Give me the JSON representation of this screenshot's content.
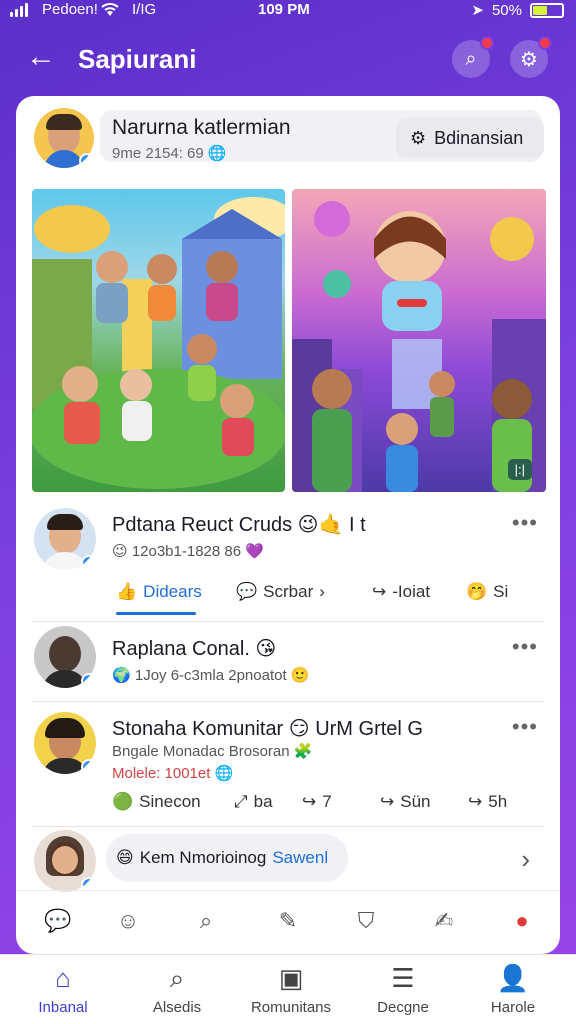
{
  "status": {
    "carrier": "Pedoen!",
    "network": "I/IG",
    "time": "109 PM",
    "battery": "50%",
    "battery_level": 0.5
  },
  "header": {
    "title": "Sapiurani"
  },
  "group": {
    "name": "Narurna katlermian",
    "meta": "9me 2154: 69",
    "join_label": "Bdinansian"
  },
  "media": {
    "badge": "|:|"
  },
  "post1": {
    "name": "Pdtana Reuct Cruds",
    "emojis": "😉🤙 I t",
    "meta": "12o3b1-1828 86",
    "actions": {
      "like": "Didears",
      "comment": "Scrbar",
      "share": "-Ioiat",
      "react": "Si"
    }
  },
  "post2": {
    "name": "Raplana Conal.",
    "meta": "1Joy 6-c3mla 2pnoatot"
  },
  "post3": {
    "name": "Stonaha Komunitar",
    "tags": "UrM  Grtel  G",
    "line1": "Bngale Monadac Brosoran",
    "line2": "Molele: 1001et",
    "actions": {
      "a1": "Sinecon",
      "a2": "ba",
      "a3": "7",
      "a4": "Sün",
      "a5": "5h"
    }
  },
  "comment": {
    "text": "Kem Nmorioinog",
    "save": "Sawenl"
  },
  "nav": {
    "items": [
      {
        "label": "Inbanal",
        "icon": "home-icon"
      },
      {
        "label": "Alsedis",
        "icon": "search-icon"
      },
      {
        "label": "Romunitans",
        "icon": "book-icon"
      },
      {
        "label": "Decgne",
        "icon": "list-icon"
      },
      {
        "label": "Harole",
        "icon": "person-icon"
      }
    ]
  }
}
